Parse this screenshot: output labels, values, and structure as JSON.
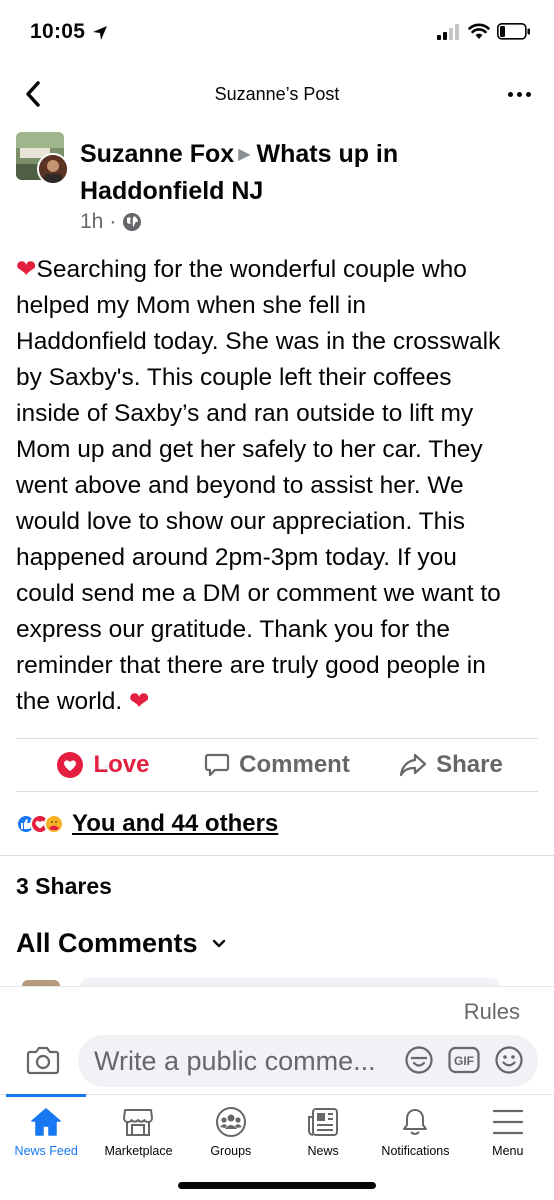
{
  "status_bar": {
    "time": "10:05"
  },
  "header": {
    "title": "Suzanne’s Post"
  },
  "post": {
    "author": "Suzanne Fox",
    "group": "Whats up in Haddonfield NJ",
    "time": "1h",
    "body_lines": [
      "Searching for the wonderful couple who",
      "helped my Mom when she fell in",
      "Haddonfield today. She was in the crosswalk",
      "by Saxby's. This couple left their coffees",
      "inside of Saxby’s and ran outside to lift my",
      "Mom up and get her safely to her car. They",
      "went above and beyond to assist her. We",
      "would love to show our appreciation. This",
      "happened around 2pm-3pm today. If you",
      "could send me a DM or comment we want to",
      "express our gratitude. Thank you for the",
      "reminder that there are truly good people in",
      "the world."
    ]
  },
  "actions": {
    "love": "Love",
    "comment": "Comment",
    "share": "Share"
  },
  "reactions": {
    "text": "You and 44 others"
  },
  "shares": "3 Shares",
  "comments": {
    "sort_label": "All Comments",
    "rules": "Rules",
    "placeholder": "Write a public comme..."
  },
  "tabs": [
    "News Feed",
    "Marketplace",
    "Groups",
    "News",
    "Notifications",
    "Menu"
  ],
  "colors": {
    "brand_blue": "#1877f2",
    "love_red": "#e41e3f",
    "secondary_text": "#65676b"
  }
}
